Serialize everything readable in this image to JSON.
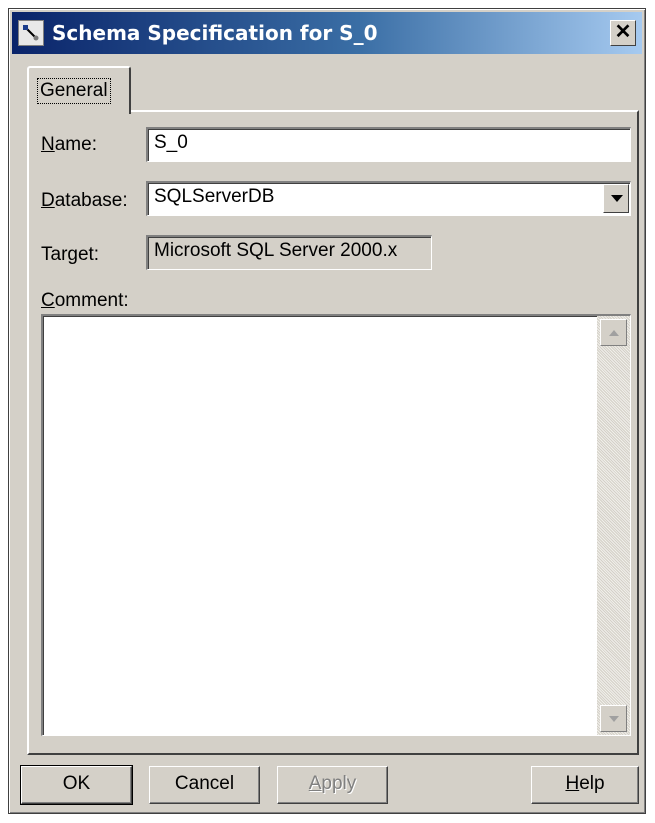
{
  "window": {
    "title": "Schema Specification for S_0",
    "close_glyph": "✕"
  },
  "tabs": [
    {
      "label": "General",
      "active": true
    }
  ],
  "form": {
    "name": {
      "label": "Name:",
      "label_mnemonic": "N",
      "label_rest": "ame:",
      "value": "S_0"
    },
    "database": {
      "label": "Database:",
      "label_mnemonic": "D",
      "label_rest": "atabase:",
      "value": "SQLServerDB"
    },
    "target": {
      "label": "Target:",
      "value": "Microsoft SQL Server 2000.x"
    },
    "comment": {
      "label": "Comment:",
      "label_mnemonic": "C",
      "label_rest": "omment:",
      "value": ""
    }
  },
  "buttons": {
    "ok": "OK",
    "cancel": "Cancel",
    "apply": "Apply",
    "apply_mnemonic": "A",
    "apply_rest": "pply",
    "help": "Help",
    "help_mnemonic": "H",
    "help_rest": "elp"
  },
  "icons": {
    "title_icon": "tool-icon",
    "close": "close-icon",
    "dropdown": "chevron-down-icon",
    "scroll_up": "scroll-up-icon",
    "scroll_down": "scroll-down-icon"
  },
  "colors": {
    "titlebar_start": "#0a246a",
    "titlebar_end": "#a6caf0",
    "dialog_face": "#d4d0c8"
  }
}
